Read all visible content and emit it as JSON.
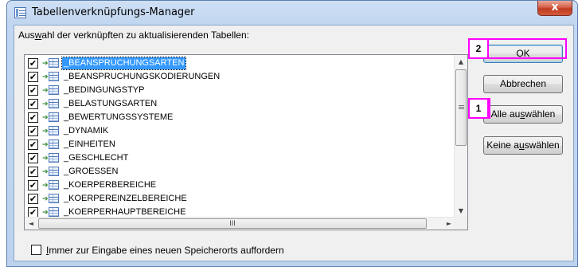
{
  "window": {
    "title": "Tabellenverknüpfungs-Manager",
    "close_glyph": "x"
  },
  "instruction": {
    "before": "Aus",
    "mnemonic": "w",
    "after": "ahl der verknüpften zu aktualisierenden Tabellen:"
  },
  "tables": [
    {
      "name": "_BEANSPRUCHUNGSARTEN",
      "checked": true,
      "selected": true
    },
    {
      "name": "_BEANSPRUCHUNGSKODIERUNGEN",
      "checked": true,
      "selected": false
    },
    {
      "name": "_BEDINGUNGSTYP",
      "checked": true,
      "selected": false
    },
    {
      "name": "_BELASTUNGSARTEN",
      "checked": true,
      "selected": false
    },
    {
      "name": "_BEWERTUNGSSYSTEME",
      "checked": true,
      "selected": false
    },
    {
      "name": "_DYNAMIK",
      "checked": true,
      "selected": false
    },
    {
      "name": "_EINHEITEN",
      "checked": true,
      "selected": false
    },
    {
      "name": "_GESCHLECHT",
      "checked": true,
      "selected": false
    },
    {
      "name": "_GROESSEN",
      "checked": true,
      "selected": false
    },
    {
      "name": "_KOERPERBEREICHE",
      "checked": true,
      "selected": false
    },
    {
      "name": "_KOERPEREINZELBEREICHE",
      "checked": true,
      "selected": false
    },
    {
      "name": "_KOERPERHAUPTBEREICHE",
      "checked": true,
      "selected": false
    }
  ],
  "check_glyph": "✔",
  "scrollbar": {
    "up": "▲",
    "down": "▼",
    "left": "◄",
    "right": "►",
    "h_grip": "III"
  },
  "buttons": {
    "ok": "OK",
    "cancel": "Abbrechen",
    "select_all": {
      "before": "Alle au",
      "mnemonic": "s",
      "after": "wählen"
    },
    "select_none": {
      "before": "Keine a",
      "mnemonic": "u",
      "after": "swählen"
    }
  },
  "callouts": {
    "ok_step": "2",
    "select_all_step": "1"
  },
  "footer": {
    "checked": false,
    "mnemonic": "I",
    "label_rest": "mmer zur Eingabe eines neuen Speicherorts auffordern"
  }
}
